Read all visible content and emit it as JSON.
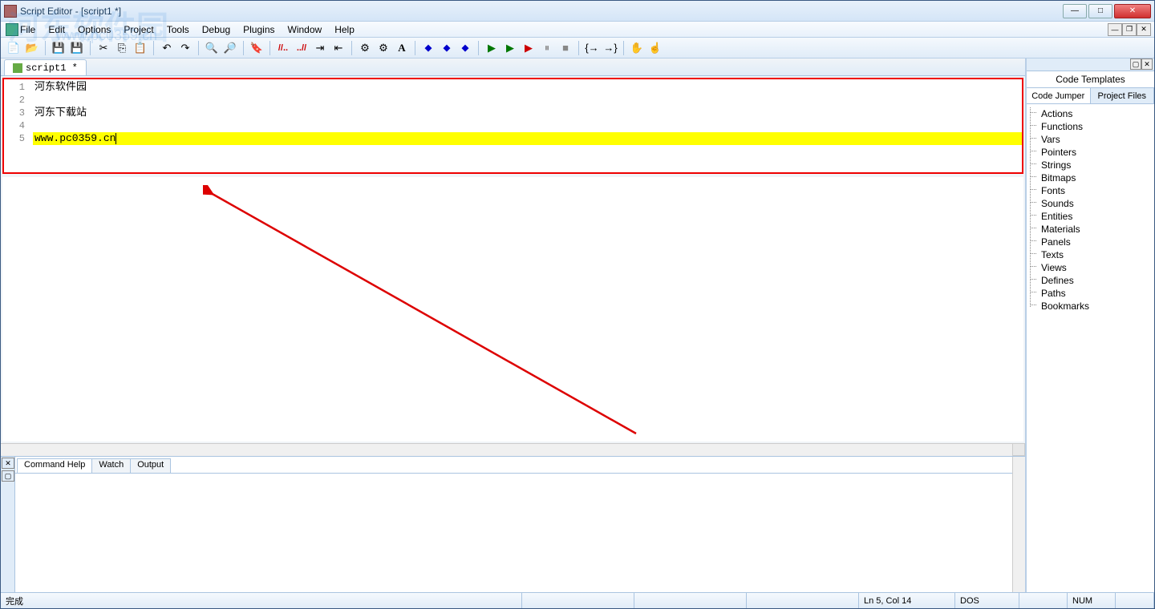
{
  "window": {
    "title": "Script Editor - [script1 *]"
  },
  "menubar": {
    "items": [
      "File",
      "Edit",
      "Options",
      "Project",
      "Tools",
      "Debug",
      "Plugins",
      "Window",
      "Help"
    ]
  },
  "editor": {
    "tab": "script1 *",
    "lines": [
      {
        "num": "1",
        "text": "河东软件园"
      },
      {
        "num": "2",
        "text": ""
      },
      {
        "num": "3",
        "text": "河东下载站"
      },
      {
        "num": "4",
        "text": ""
      },
      {
        "num": "5",
        "text": "www.pc0359.cn",
        "highlighted": true
      }
    ]
  },
  "sidepanel": {
    "title": "Code Templates",
    "tabs": [
      "Code Jumper",
      "Project Files"
    ],
    "tree": [
      "Actions",
      "Functions",
      "Vars",
      "Pointers",
      "Strings",
      "Bitmaps",
      "Fonts",
      "Sounds",
      "Entities",
      "Materials",
      "Panels",
      "Texts",
      "Views",
      "Defines",
      "Paths",
      "Bookmarks"
    ]
  },
  "bottompanel": {
    "tabs": [
      "Command Help",
      "Watch",
      "Output"
    ]
  },
  "statusbar": {
    "ready": "完成",
    "pos": "Ln 5, Col 14",
    "enc": "DOS",
    "num": "NUM"
  },
  "watermark": {
    "logo": "河东软件园",
    "url": "www.pc0359.cn"
  }
}
